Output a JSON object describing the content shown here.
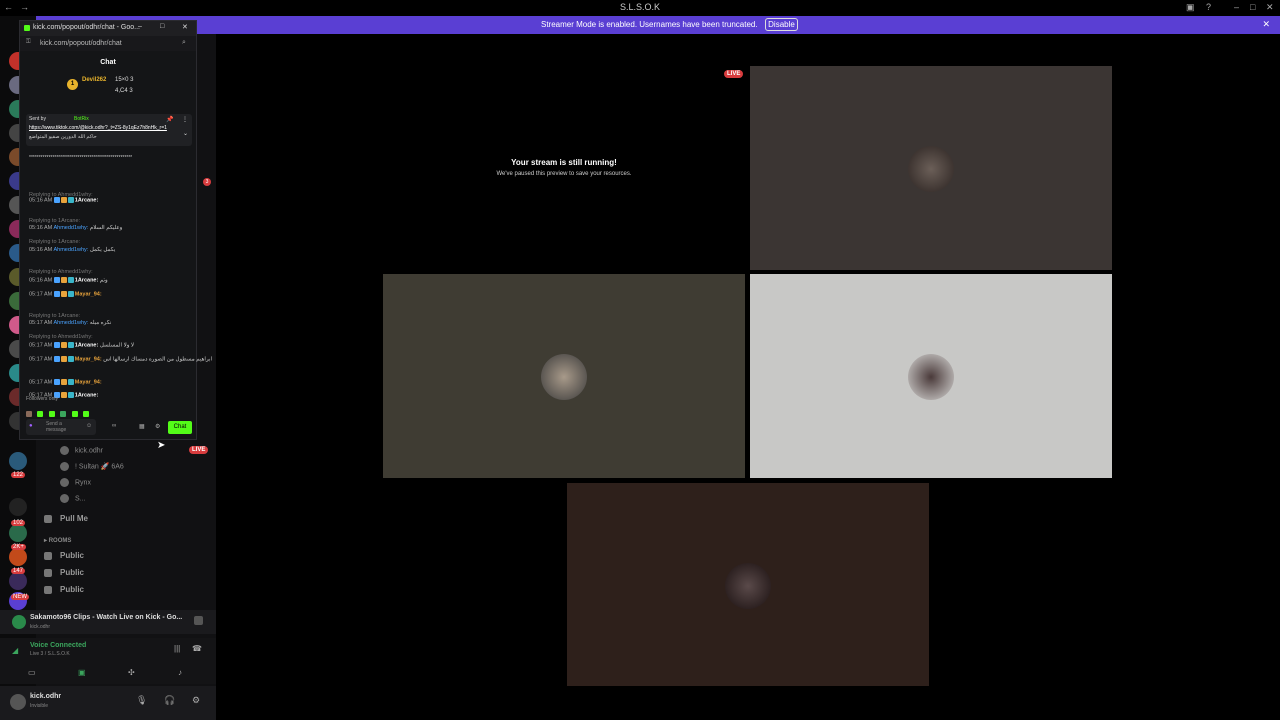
{
  "window": {
    "title": "S.L.S.O.K"
  },
  "banner": {
    "text": "Streamer Mode is enabled. Usernames have been truncated.",
    "disable_label": "Disable"
  },
  "rail_badges": [
    "122",
    "102",
    "2K+",
    "147",
    "NEW"
  ],
  "voice_users": [
    "kick.odhr",
    "! Sultan 🚀 6A6",
    "Rynx",
    "S..."
  ],
  "live_label": "LIVE",
  "channels": [
    {
      "label": "Pull Me",
      "kind": "voice"
    },
    {
      "label": "ROOMS",
      "kind": "category"
    },
    {
      "label": "Public",
      "kind": "voice"
    },
    {
      "label": "Public",
      "kind": "voice"
    },
    {
      "label": "Public",
      "kind": "voice"
    }
  ],
  "activity": {
    "title": "Sakamoto96 Clips - Watch Live on Kick - Go...",
    "sub": "kick.odhr"
  },
  "voice": {
    "status": "Voice Connected",
    "channel": "Live 3 / S.L.S.O.K"
  },
  "user": {
    "name": "kick.odhr",
    "status": "Invisible"
  },
  "popout": {
    "window_title": "kick.com/popout/odhr/chat - Goo...",
    "url": "kick.com/popout/odhr/chat",
    "header": "Chat",
    "top_user": "Devil262",
    "top_stats": [
      "15×0 3",
      "4,C4 3"
    ],
    "pinned_sender": "Sent by",
    "pinned_bot": "BotRix",
    "pinned_link": "https://www.tiktok.com/@kick.odhr?_t=ZS-8y1qEz7h8nHk_r=1",
    "pinned_text": "حاكم الله الدورين صفيو المتواضع",
    "messages": [
      {
        "ts": "05:16 AM",
        "user": "1Arcane:",
        "text": "",
        "color": "white",
        "reply": "Replying to Ahmedd1why:"
      },
      {
        "ts": "05:16 AM",
        "user": "Ahmedd1why:",
        "text": "وعليكم السلام",
        "color": "blue",
        "reply": "Replying to 1Arcane:"
      },
      {
        "ts": "05:16 AM",
        "user": "Ahmedd1why:",
        "text": "يكمل يكمل",
        "color": "blue",
        "reply": "Replying to 1Arcane:"
      },
      {
        "ts": "05:16 AM",
        "user": "1Arcane:",
        "text": "وتم",
        "color": "white",
        "reply": "Replying to Ahmedd1why:"
      },
      {
        "ts": "05:17 AM",
        "user": "Mayar_94:",
        "text": "",
        "color": "orange",
        "reply": ""
      },
      {
        "ts": "05:17 AM",
        "user": "Ahmedd1why:",
        "text": "نكره ميله",
        "color": "blue",
        "reply": "Replying to 1Arcane:"
      },
      {
        "ts": "05:17 AM",
        "user": "1Arcane:",
        "text": "لا ولا المسلسل",
        "color": "white",
        "reply": "Replying to Ahmedd1why:"
      },
      {
        "ts": "05:17 AM",
        "user": "Mayar_94:",
        "text": "ابراهيم مسطول من الصوره دمساك ارسالها اس",
        "color": "orange",
        "reply": ""
      },
      {
        "ts": "05:17 AM",
        "user": "Mayar_94:",
        "text": "",
        "color": "orange",
        "reply": ""
      },
      {
        "ts": "05:17 AM",
        "user": "1Arcane:",
        "text": "",
        "color": "white",
        "reply": ""
      }
    ],
    "followers_only": "Followers only",
    "input_placeholder": "Send a message",
    "chat_button": "Chat",
    "unread_badge": "3"
  },
  "stream": {
    "live_label": "LIVE",
    "paused_title": "Your stream is still running!",
    "paused_sub": "We've paused this preview to save your resources."
  },
  "colors": {
    "accent": "#5a3fd3",
    "kick_green": "#53fc18",
    "live_red": "#d83c3e",
    "tile_brown": "#3b3533",
    "tile_olive": "#3f3c33",
    "tile_light": "#c8c8c6",
    "tile_dark_brown": "#2e201b"
  }
}
